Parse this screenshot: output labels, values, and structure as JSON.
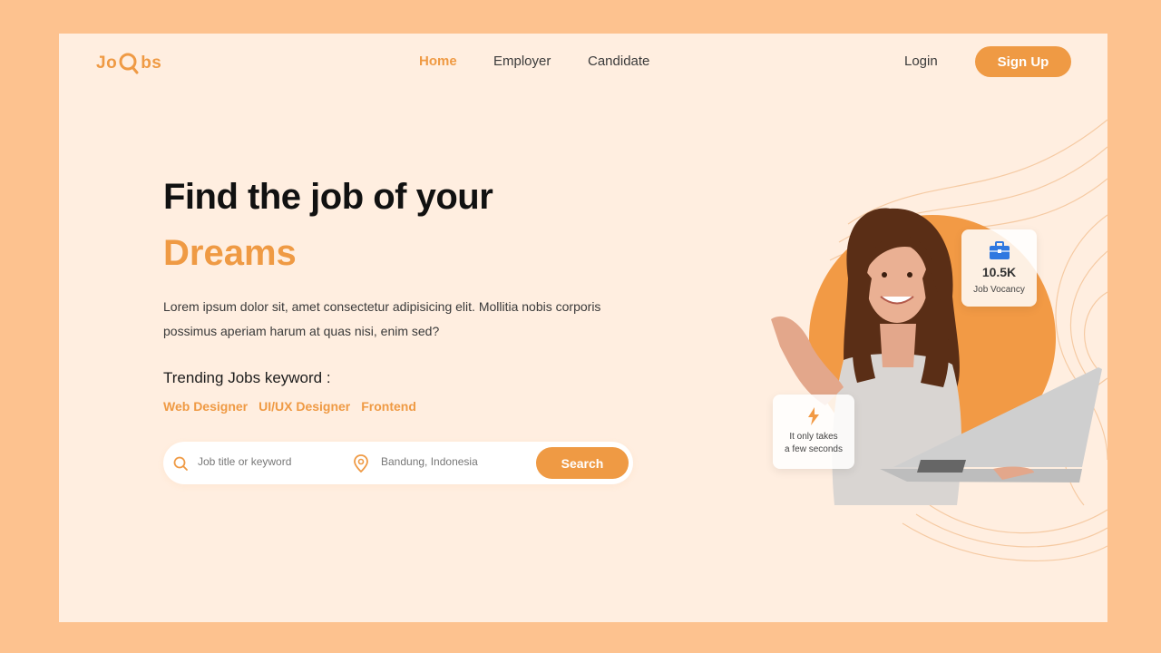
{
  "brand": {
    "logo_left": "Jo",
    "logo_right": "bs"
  },
  "nav": {
    "items": [
      {
        "label": "Home",
        "active": true
      },
      {
        "label": "Employer",
        "active": false
      },
      {
        "label": "Candidate",
        "active": false
      }
    ],
    "login_label": "Login",
    "signup_label": "Sign Up"
  },
  "hero": {
    "headline_line1": "Find the job of your",
    "headline_line2": "Dreams",
    "description": "Lorem ipsum dolor sit, amet consectetur adipisicing elit. Mollitia nobis corporis possimus aperiam harum at quas nisi, enim sed?",
    "trending_title": "Trending Jobs keyword :",
    "trending_tags": [
      "Web Designer",
      "UI/UX Designer",
      "Frontend"
    ]
  },
  "search": {
    "keyword_placeholder": "Job title or keyword",
    "location_placeholder": "Bandung, Indonesia",
    "button_label": "Search"
  },
  "stats": {
    "vacancy_value": "10.5K",
    "vacancy_label": "Job Vocancy",
    "speed_label": "It only takes\na few seconds"
  },
  "colors": {
    "accent": "#ef9a44",
    "background": "#ffeee0",
    "outer": "#fdc28f"
  },
  "icons": [
    "magnifier-logo-icon",
    "search-icon",
    "location-pin-icon",
    "briefcase-icon",
    "lightning-icon"
  ]
}
